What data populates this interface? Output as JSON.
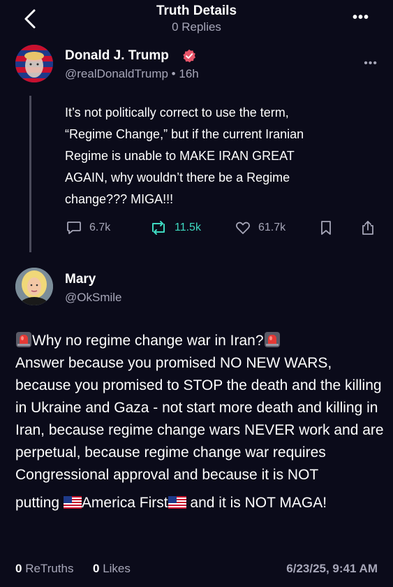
{
  "header": {
    "title": "Truth Details",
    "subtitle": "0 Replies"
  },
  "post": {
    "author": "Donald J. Trump",
    "handle": "@realDonaldTrump • 16h",
    "body": "It’s not politically correct to use the term,\n“Regime Change,” but if the current Iranian\nRegime is unable to MAKE IRAN GREAT\nAGAIN, why wouldn’t there be a Regime\nchange??? MIGA!!!",
    "replies": "6.7k",
    "retruths": "11.5k",
    "likes": "61.7k"
  },
  "reply": {
    "author": "Mary",
    "handle": "@OkSmile",
    "line1": "Why no regime change war in Iran?",
    "body": "Answer because you promised NO NEW WARS, because you promised to STOP the death and the killing in Ukraine and Gaza - not start more death and killing in Iran, because regime change wars NEVER work and are perpetual, because regime change war requires Congressional approval and because it is NOT",
    "last_a": "putting ",
    "last_b": "America First",
    "last_c": " and it is NOT MAGA!"
  },
  "footer": {
    "retruths_count": "0",
    "retruths_label": "ReTruths",
    "likes_count": "0",
    "likes_label": "Likes",
    "date": "6/23/25, 9:41 AM"
  },
  "colors": {
    "background": "#0b0b1a",
    "muted": "#a6a6b8",
    "retruth": "#3ed9c1",
    "verified": "#e8556a"
  }
}
